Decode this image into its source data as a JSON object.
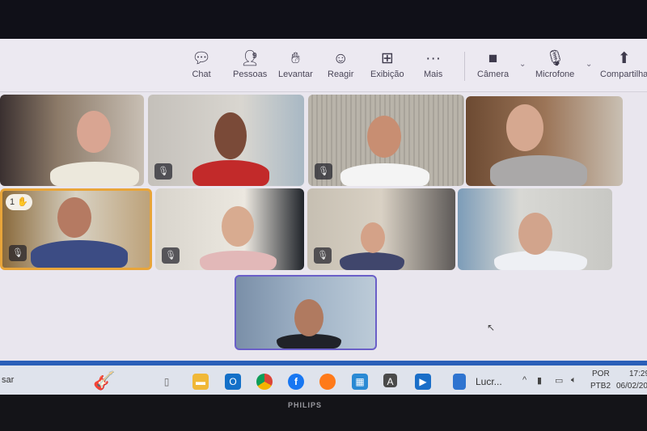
{
  "toolbar": {
    "chat": "Chat",
    "people": "Pessoas",
    "people_count": "9",
    "raise": "Levantar",
    "react": "Reagir",
    "view": "Exibição",
    "more": "Mais",
    "camera": "Câmera",
    "mic": "Microfone",
    "share": "Compartilha"
  },
  "participants": {
    "raised_hand_count": "1",
    "tiles": 9
  },
  "taskbar": {
    "search": "sar",
    "pinned_doc": "Lucr...",
    "lang1": "POR",
    "lang2": "PTB2",
    "time": "17:29",
    "date": "06/02/20"
  },
  "monitor": {
    "brand": "PHILIPS"
  },
  "colors": {
    "active_speaker": "#e8a53a",
    "taskbar_accent": "#2a5fb8"
  }
}
